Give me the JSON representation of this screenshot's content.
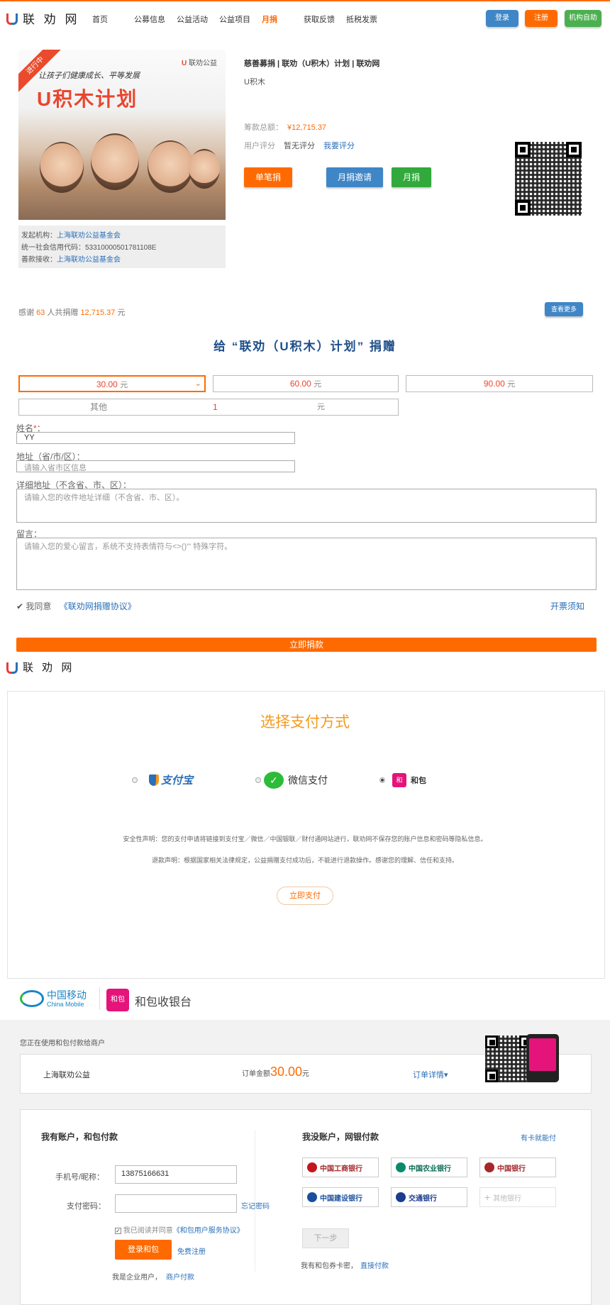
{
  "nav": {
    "logo": "联 劝 网",
    "items": [
      "首页",
      "公募信息",
      "公益活动",
      "公益项目",
      "月捐",
      "获取反馈",
      "抵税发票"
    ],
    "login": "登录",
    "register": "注册",
    "org_help": "机构自助",
    "colors": {
      "login": "#3f86c6",
      "register": "#ff6a00",
      "org_help": "#4caf50"
    }
  },
  "project": {
    "ribbon": "进行中",
    "image_slogan": "让孩子们健康成长、平等发展",
    "image_title": "U积木计划",
    "image_brand": "联劝公益",
    "title": "慈善募捐 | 联劝（U积木）计划 | 联劝网",
    "subtitle": "U积木",
    "total_label": "筹款总额：",
    "total_value": "¥12,715.37",
    "rating_label": "用户评分",
    "rating_value": "暂无评分",
    "rate_link": "我要评分",
    "btn_single": "单笔捐",
    "btn_invite": "月捐邀请",
    "btn_monthly": "月捐",
    "org_label": "发起机构：",
    "org_name": "上海联劝公益基金会",
    "credit_code": "统一社会信用代码：53310000501781108E",
    "receiver_label": "善款接收：",
    "receiver_name": "上海联劝公益基金会"
  },
  "thanks": {
    "prefix": "感谢",
    "count": "63",
    "middle": "人共捐赠",
    "amount": "12,715.37",
    "suffix": "元",
    "more": "查看更多"
  },
  "donate": {
    "heading": "给 “联劝（U积木）计划” 捐赠",
    "amounts": [
      {
        "value": "30.00",
        "unit": "元"
      },
      {
        "value": "60.00",
        "unit": "元"
      },
      {
        "value": "90.00",
        "unit": "元"
      }
    ],
    "selected_index": 0,
    "other_label": "其他",
    "other_value": "1",
    "other_unit": "元",
    "name_label": "姓名",
    "name_required": "*",
    "name_suffix": "：",
    "name_value": "YY",
    "address_label": "地址（省/市/区）：",
    "address_placeholder": "请输入省市区信息",
    "detail_label": "详细地址（不含省、市、区）：",
    "detail_placeholder": "请输入您的收件地址详细（不含省、市、区）。",
    "message_label": "留言：",
    "message_placeholder": "请输入您的爱心留言，系统不支持表情符与<>()'\" 特殊字符。",
    "agree_text": "我同意",
    "agreement_link": "《联劝网捐赠协议》",
    "invoice_link": "开票须知",
    "submit": "立即捐款"
  },
  "payment": {
    "logo": "联 劝 网",
    "title": "选择支付方式",
    "options": [
      {
        "name": "支付宝",
        "icon": "alipay-logo-icon",
        "selected": false
      },
      {
        "name": "微信支付",
        "icon": "wechat-pay-icon",
        "selected": false
      },
      {
        "name": "和包",
        "icon": "hebao-icon",
        "selected": true
      }
    ],
    "security_note": "安全性声明：您的支付申请将链接到支付宝／微信／中国银联／财付通网站进行，联劝网不保存您的账户信息和密码等隐私信息。",
    "refund_note": "退款声明：根据国家相关法律规定，公益捐赠支付成功后，不能进行退款操作。感谢您的理解、信任和支持。",
    "pay_now": "立即支付"
  },
  "cashier": {
    "brand_cn": "中国移动",
    "brand_en": "China Mobile",
    "hebao_badge": "和包",
    "title": "和包收银台",
    "merchant_note": "您正在使用和包付款给商户",
    "merchant": "上海联劝公益",
    "order_amount_label": "订单金额",
    "order_amount": "30.00",
    "order_amount_unit": "元",
    "order_detail": "订单详情",
    "has_account_title": "我有账户，和包付款",
    "phone_label": "手机号/昵称：",
    "phone_value": "13875166631",
    "password_label": "支付密码：",
    "forgot": "忘记密码",
    "agree_text": "我已阅读并同意",
    "agreement_link": "《和包用户服务协议》",
    "login_pay": "登录和包",
    "free_register": "免费注册",
    "enterprise_text": "我是企业用户，",
    "merchant_pay": "商户付款",
    "no_account_title": "我没账户，网银付款",
    "card_pay": "有卡就能付",
    "banks": [
      {
        "name": "中国工商银行",
        "color": "#c4161c"
      },
      {
        "name": "中国农业银行",
        "color": "#0b8a6b"
      },
      {
        "name": "中国银行",
        "color": "#a4282d"
      },
      {
        "name": "中国建设银行",
        "color": "#1a4f9c"
      },
      {
        "name": "交通银行",
        "color": "#1a3d8f"
      },
      {
        "name": "其他银行",
        "color": "#bbbbbb"
      }
    ],
    "next_step": "下一步",
    "coupon_text": "我有和包券卡密，",
    "direct_pay": "直接付款"
  }
}
